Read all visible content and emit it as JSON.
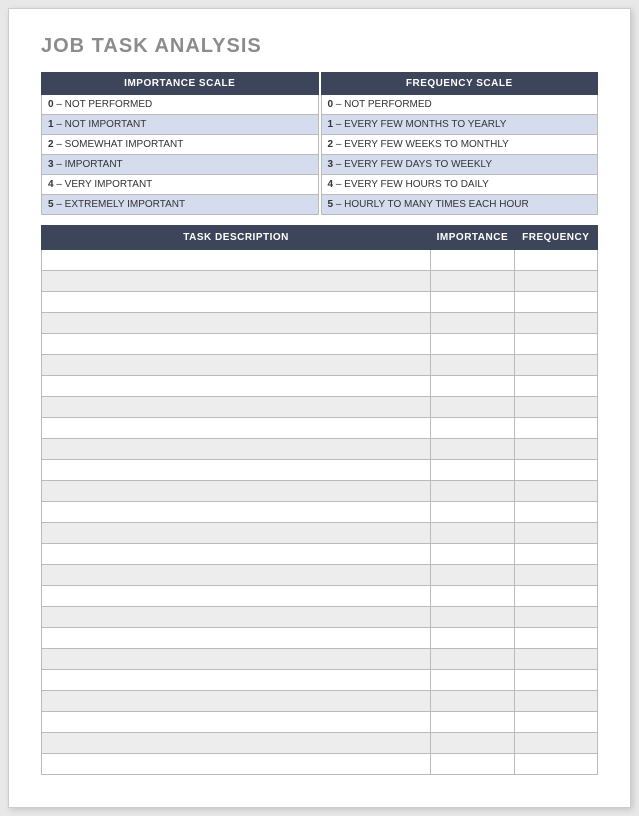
{
  "title": "JOB TASK ANALYSIS",
  "scales": {
    "importance": {
      "header": "IMPORTANCE SCALE",
      "rows": [
        {
          "num": "0",
          "label": " – NOT PERFORMED"
        },
        {
          "num": "1",
          "label": " – NOT IMPORTANT"
        },
        {
          "num": "2",
          "label": " – SOMEWHAT IMPORTANT"
        },
        {
          "num": "3",
          "label": " – IMPORTANT"
        },
        {
          "num": "4",
          "label": " – VERY IMPORTANT"
        },
        {
          "num": "5",
          "label": " – EXTREMELY IMPORTANT"
        }
      ]
    },
    "frequency": {
      "header": "FREQUENCY SCALE",
      "rows": [
        {
          "num": "0",
          "label": " – NOT PERFORMED"
        },
        {
          "num": "1",
          "label": " – EVERY FEW MONTHS TO YEARLY"
        },
        {
          "num": "2",
          "label": " – EVERY FEW WEEKS TO MONTHLY"
        },
        {
          "num": "3",
          "label": " – EVERY FEW DAYS TO WEEKLY"
        },
        {
          "num": "4",
          "label": " – EVERY FEW HOURS TO DAILY"
        },
        {
          "num": "5",
          "label": " – HOURLY TO MANY TIMES EACH HOUR"
        }
      ]
    }
  },
  "task_table": {
    "headers": {
      "description": "TASK DESCRIPTION",
      "importance": "IMPORTANCE",
      "frequency": "FREQUENCY"
    },
    "rows": [
      {
        "desc": "",
        "imp": "",
        "freq": ""
      },
      {
        "desc": "",
        "imp": "",
        "freq": ""
      },
      {
        "desc": "",
        "imp": "",
        "freq": ""
      },
      {
        "desc": "",
        "imp": "",
        "freq": ""
      },
      {
        "desc": "",
        "imp": "",
        "freq": ""
      },
      {
        "desc": "",
        "imp": "",
        "freq": ""
      },
      {
        "desc": "",
        "imp": "",
        "freq": ""
      },
      {
        "desc": "",
        "imp": "",
        "freq": ""
      },
      {
        "desc": "",
        "imp": "",
        "freq": ""
      },
      {
        "desc": "",
        "imp": "",
        "freq": ""
      },
      {
        "desc": "",
        "imp": "",
        "freq": ""
      },
      {
        "desc": "",
        "imp": "",
        "freq": ""
      },
      {
        "desc": "",
        "imp": "",
        "freq": ""
      },
      {
        "desc": "",
        "imp": "",
        "freq": ""
      },
      {
        "desc": "",
        "imp": "",
        "freq": ""
      },
      {
        "desc": "",
        "imp": "",
        "freq": ""
      },
      {
        "desc": "",
        "imp": "",
        "freq": ""
      },
      {
        "desc": "",
        "imp": "",
        "freq": ""
      },
      {
        "desc": "",
        "imp": "",
        "freq": ""
      },
      {
        "desc": "",
        "imp": "",
        "freq": ""
      },
      {
        "desc": "",
        "imp": "",
        "freq": ""
      },
      {
        "desc": "",
        "imp": "",
        "freq": ""
      },
      {
        "desc": "",
        "imp": "",
        "freq": ""
      },
      {
        "desc": "",
        "imp": "",
        "freq": ""
      },
      {
        "desc": "",
        "imp": "",
        "freq": ""
      }
    ]
  }
}
